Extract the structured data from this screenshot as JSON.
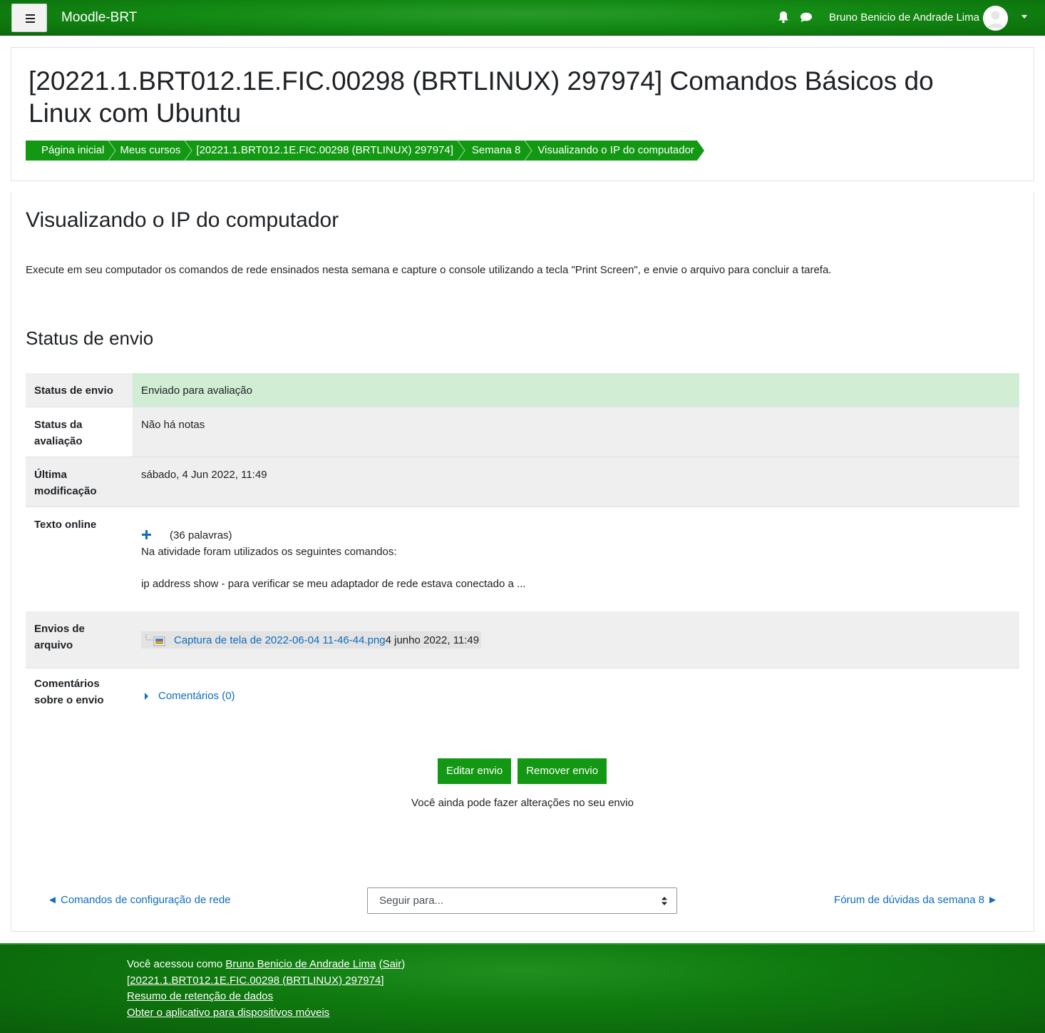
{
  "navbar": {
    "site_name": "Moodle-BRT",
    "user_name": "Bruno Benicio de Andrade Lima"
  },
  "header": {
    "course_title": "[20221.1.BRT012.1E.FIC.00298 (BRTLINUX) 297974] Comandos Básicos do Linux com Ubuntu",
    "breadcrumb": [
      "Página inicial",
      "Meus cursos",
      "[20221.1.BRT012.1E.FIC.00298 (BRTLINUX) 297974]",
      "Semana 8",
      "Visualizando o IP do computador"
    ]
  },
  "main": {
    "page_heading": "Visualizando o IP do computador",
    "intro": "Execute em seu computador os comandos de rede ensinados nesta semana e capture o console utilizando a tecla \"Print Screen\", e envie o arquivo para concluir a tarefa.",
    "section_heading": "Status de envio",
    "rows": {
      "status_envio": {
        "label": "Status de envio",
        "value": "Enviado para avaliação"
      },
      "status_avaliacao": {
        "label_1": "Status da",
        "label_2": "avaliação",
        "value": "Não há notas"
      },
      "ultima_mod": {
        "label_1": "Última",
        "label_2": "modificação",
        "value": "sábado, 4 Jun 2022, 11:49"
      },
      "texto_online": {
        "label": "Texto online",
        "word_count": "(36 palavras)",
        "line1": "Na atividade foram utilizados os seguintes comandos:",
        "line2": "ip address show - para verificar se meu adaptador de rede estava conectado a ..."
      },
      "envios": {
        "label_1": "Envios de",
        "label_2": "arquivo",
        "file_name": "Captura de tela de 2022-06-04 11-46-44.png",
        "file_date": "4 junho 2022, 11:49"
      },
      "comentarios": {
        "label_1": "Comentários",
        "label_2": "sobre o envio",
        "link": "Comentários (0)"
      }
    },
    "buttons": {
      "edit": "Editar envio",
      "remove": "Remover envio"
    },
    "note": "Você ainda pode fazer alterações no seu envio",
    "nav": {
      "prev": "◄ Comandos de configuração de rede",
      "jump_placeholder": "Seguir para...",
      "next": "Fórum de dúvidas da semana 8 ►"
    }
  },
  "footer": {
    "logged_prefix": "Você acessou como",
    "user": "Bruno Benicio de Andrade Lima",
    "logout": "Sair",
    "course_link": "[20221.1.BRT012.1E.FIC.00298 (BRTLINUX) 297974]",
    "data_retention": "Resumo de retenção de dados",
    "mobile_app": "Obter o aplicativo para dispositivos móveis"
  },
  "colors": {
    "brand_green": "#139813",
    "link_blue": "#0f6cbf",
    "success_bg": "#d1edd3",
    "row_gray": "#efefef"
  }
}
